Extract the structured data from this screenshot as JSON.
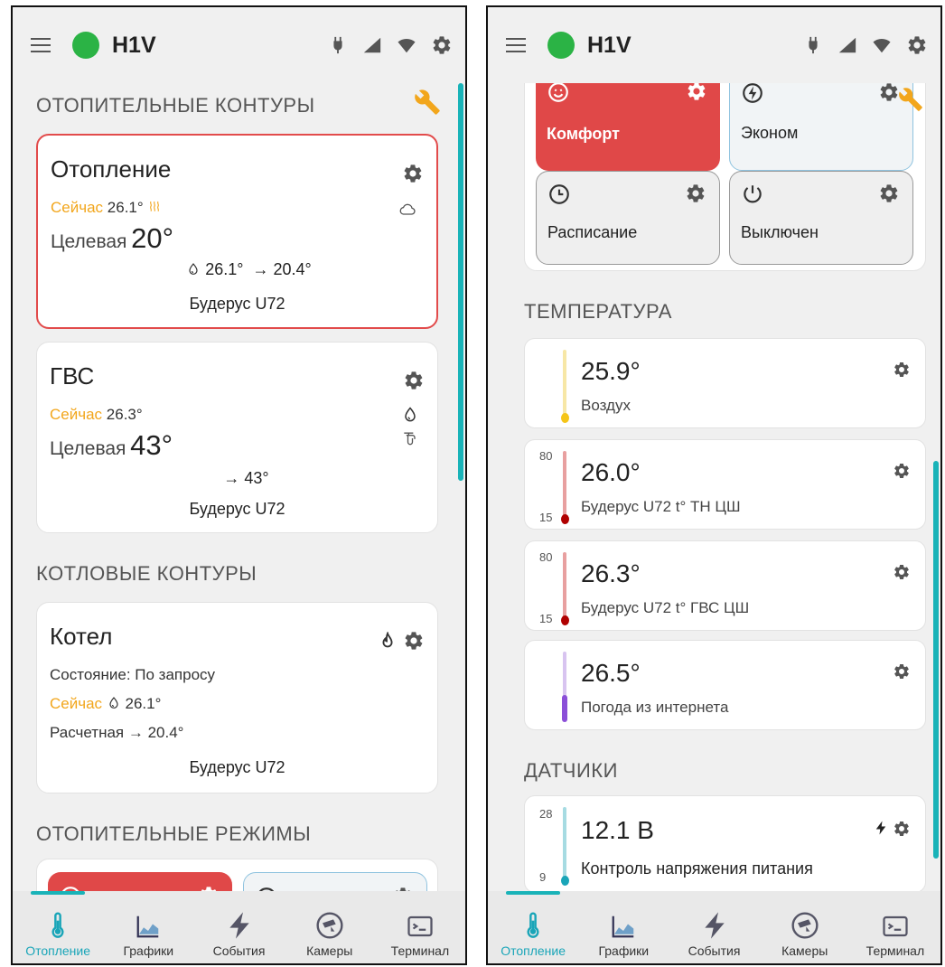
{
  "app": {
    "title": "H1V"
  },
  "left": {
    "sections": {
      "heating_circuits": "ОТОПИТЕЛЬНЫЕ КОНТУРЫ",
      "boiler_circuits": "КОТЛОВЫЕ КОНТУРЫ",
      "heating_modes": "ОТОПИТЕЛЬНЫЕ РЕЖИМЫ"
    },
    "heating": {
      "title": "Отопление",
      "now_label": "Сейчас",
      "now_value": "26.1°",
      "target_label": "Целевая",
      "target_value": "20°",
      "flow": "26.1°",
      "calc": "→ 20.4°",
      "source": "Будерус U72"
    },
    "dhw": {
      "title": "ГВС",
      "now_label": "Сейчас",
      "now_value": "26.3°",
      "target_label": "Целевая",
      "target_value": "43°",
      "calc": "→ 43°",
      "source": "Будерус U72"
    },
    "boiler": {
      "title": "Котел",
      "state": "Состояние: По запросу",
      "now_label": "Сейчас",
      "now_value": "26.1°",
      "calc": "Расчетная → 20.4°",
      "source": "Будерус U72"
    }
  },
  "right": {
    "modes": {
      "comfort": "Комфорт",
      "eco": "Эконом",
      "schedule": "Расписание",
      "off": "Выключен"
    },
    "sections": {
      "temperature": "ТЕМПЕРАТУРА",
      "sensors": "ДАТЧИКИ"
    },
    "temps": [
      {
        "value": "25.9°",
        "name": "Воздух",
        "scale_top": "",
        "scale_bottom": ""
      },
      {
        "value": "26.0°",
        "name": "Будерус U72 t° ТН ЦШ",
        "scale_top": "80",
        "scale_bottom": "15"
      },
      {
        "value": "26.3°",
        "name": "Будерус U72 t° ГВС ЦШ",
        "scale_top": "80",
        "scale_bottom": "15"
      },
      {
        "value": "26.5°",
        "name": "Погода из интернета",
        "scale_top": "",
        "scale_bottom": ""
      }
    ],
    "sensor": {
      "value": "12.1 В",
      "name": "Контроль напряжения питания",
      "scale_top": "28",
      "scale_bottom": "9"
    }
  },
  "nav": {
    "heating": "Отопление",
    "charts": "Графики",
    "events": "События",
    "cameras": "Камеры",
    "terminal": "Терминал"
  },
  "colors": {
    "accent": "#19b3b8",
    "comfort_red": "#e04848",
    "now_orange": "#f2a61c",
    "online_green": "#2bb345"
  }
}
